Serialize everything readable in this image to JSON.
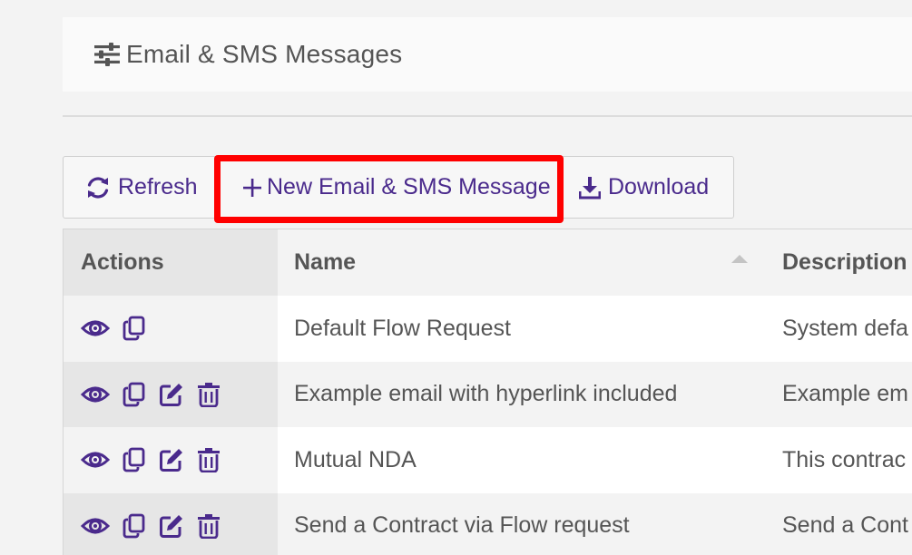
{
  "header": {
    "title": "Email & SMS Messages",
    "icon": "sliders-icon"
  },
  "toolbar": {
    "refresh_label": "Refresh",
    "new_label": "New Email & SMS Message",
    "download_label": "Download"
  },
  "table": {
    "columns": [
      "Actions",
      "Name",
      "Description"
    ],
    "rows": [
      {
        "name": "Default Flow Request",
        "description": "System defa",
        "actions": [
          "view-icon",
          "copy-icon"
        ]
      },
      {
        "name": "Example email with hyperlink included",
        "description": "Example em",
        "actions": [
          "view-icon",
          "copy-icon",
          "edit-icon",
          "trash-icon"
        ]
      },
      {
        "name": "Mutual NDA",
        "description": "This contrac",
        "actions": [
          "view-icon",
          "copy-icon",
          "edit-icon",
          "trash-icon"
        ]
      },
      {
        "name": "Send a Contract via Flow request",
        "description": "Send a Cont",
        "actions": [
          "view-icon",
          "copy-icon",
          "edit-icon",
          "trash-icon"
        ]
      }
    ]
  },
  "colors": {
    "accent": "#4a2a8c",
    "highlight": "#ff0000"
  }
}
